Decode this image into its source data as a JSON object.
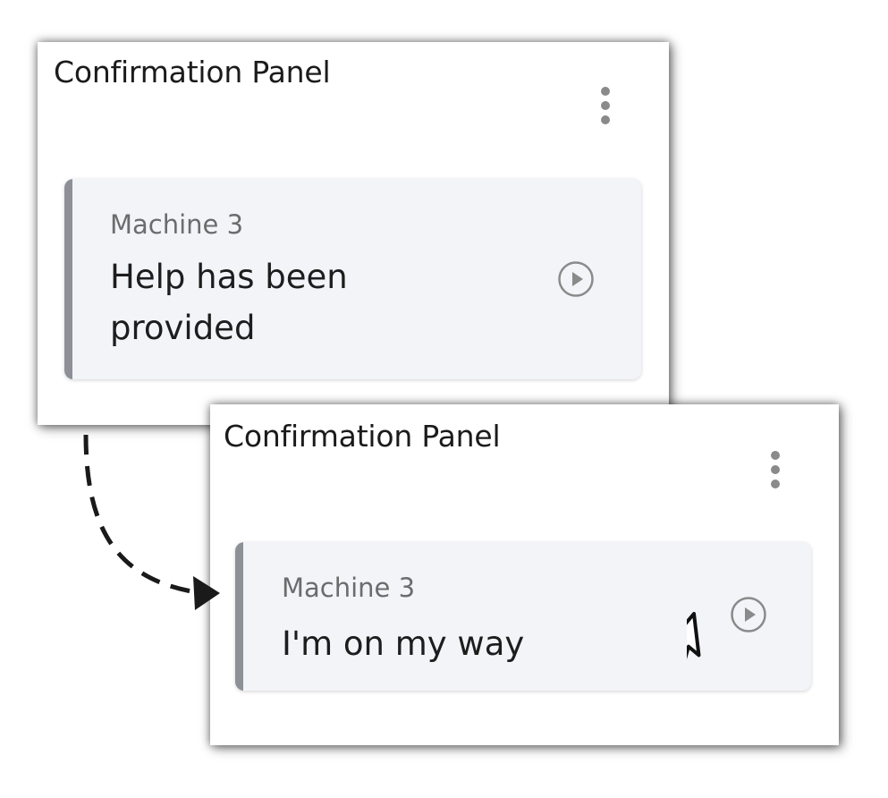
{
  "panels": [
    {
      "title": "Confirmation Panel",
      "card": {
        "machine": "Machine 3",
        "message": "Help has been provided"
      },
      "menu_icon": "more-vertical-icon",
      "action_icon": "play-circle-icon"
    },
    {
      "title": "Confirmation Panel",
      "card": {
        "machine": "Machine 3",
        "message": "I'm on my way"
      },
      "menu_icon": "more-vertical-icon",
      "action_icon": "play-circle-icon"
    }
  ],
  "icons": {
    "transition": "dashed-arrow-icon",
    "pointer": "mouse-pointer-icon"
  },
  "colors": {
    "card_background": "#f3f4f8",
    "card_accent": "#8d9097",
    "icon_gray": "#8a8a8a",
    "title_text": "#1b1b1b",
    "subtitle_text": "#6c6c6c"
  }
}
